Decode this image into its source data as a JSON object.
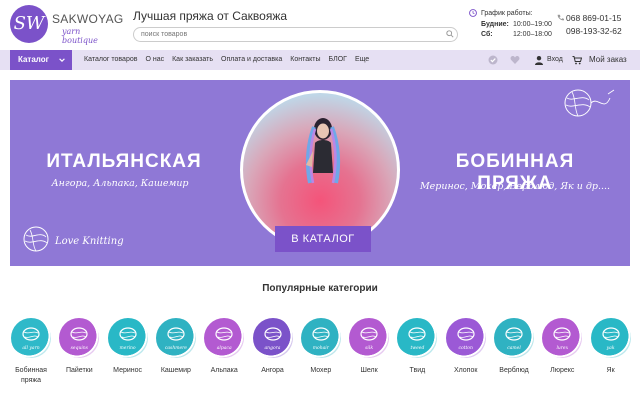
{
  "brand": {
    "logo_mark": "SW",
    "name": "SAKWOYAG",
    "subtitle": "yarn boutique"
  },
  "header": {
    "tagline": "Лучшая пряжа от Саквояжа",
    "search_placeholder": "поиск товаров",
    "schedule": {
      "title": "График работы:",
      "weekdays_label": "Будние:",
      "weekdays_hours": "10:00–19:00",
      "saturday_label": "Сб:",
      "saturday_hours": "12:00–18:00"
    },
    "phones": [
      "068 869-01-15",
      "098-193-32-62"
    ]
  },
  "nav": {
    "catalog_button": "Каталог",
    "links": [
      "Каталог товаров",
      "О нас",
      "Как заказать",
      "Оплата и доставка",
      "Контакты",
      "БЛОГ",
      "Еще"
    ],
    "login": "Вход",
    "order": "Мой заказ"
  },
  "banner": {
    "left_title": "ИТАЛЬЯНСКАЯ",
    "left_subtitle": "Ангора, Альпака, Кашемир",
    "right_title": "БОБИННАЯ ПРЯЖА",
    "right_subtitle": "Меринос, Мохер, Верблюд, Як и др....",
    "button": "В КАТАЛОГ",
    "script_text": "Love Knitting"
  },
  "categories_title": "Популярные категории",
  "categories": [
    {
      "label": "Бобинная пряжа",
      "badge": "all yarn",
      "color": "#2fb9c9"
    },
    {
      "label": "Пайетки",
      "badge": "sequins",
      "color": "#b35ad1"
    },
    {
      "label": "Меринос",
      "badge": "merino",
      "color": "#29b8c6"
    },
    {
      "label": "Кашемир",
      "badge": "cashmere",
      "color": "#2fb2c2"
    },
    {
      "label": "Альпака",
      "badge": "alpaca",
      "color": "#b35ad1"
    },
    {
      "label": "Ангора",
      "badge": "angora",
      "color": "#7b52c9"
    },
    {
      "label": "Мохер",
      "badge": "mohair",
      "color": "#2fb2c2"
    },
    {
      "label": "Шелк",
      "badge": "silk",
      "color": "#b35ad1"
    },
    {
      "label": "Твид",
      "badge": "tweed",
      "color": "#29b8c6"
    },
    {
      "label": "Хлопок",
      "badge": "cotton",
      "color": "#9b59d6"
    },
    {
      "label": "Верблюд",
      "badge": "camel",
      "color": "#2fb2c2"
    },
    {
      "label": "Люрекс",
      "badge": "lurex",
      "color": "#b35ad1"
    },
    {
      "label": "Як",
      "badge": "yak",
      "color": "#29b8c6"
    }
  ],
  "colors": {
    "accent": "#7b52c9",
    "banner": "#8f78d6",
    "nav": "#e6e0f3"
  },
  "icons": [
    "search-icon",
    "clock-icon",
    "phone-icon",
    "chevron-down-icon",
    "check-icon",
    "heart-icon",
    "user-icon",
    "cart-icon"
  ]
}
